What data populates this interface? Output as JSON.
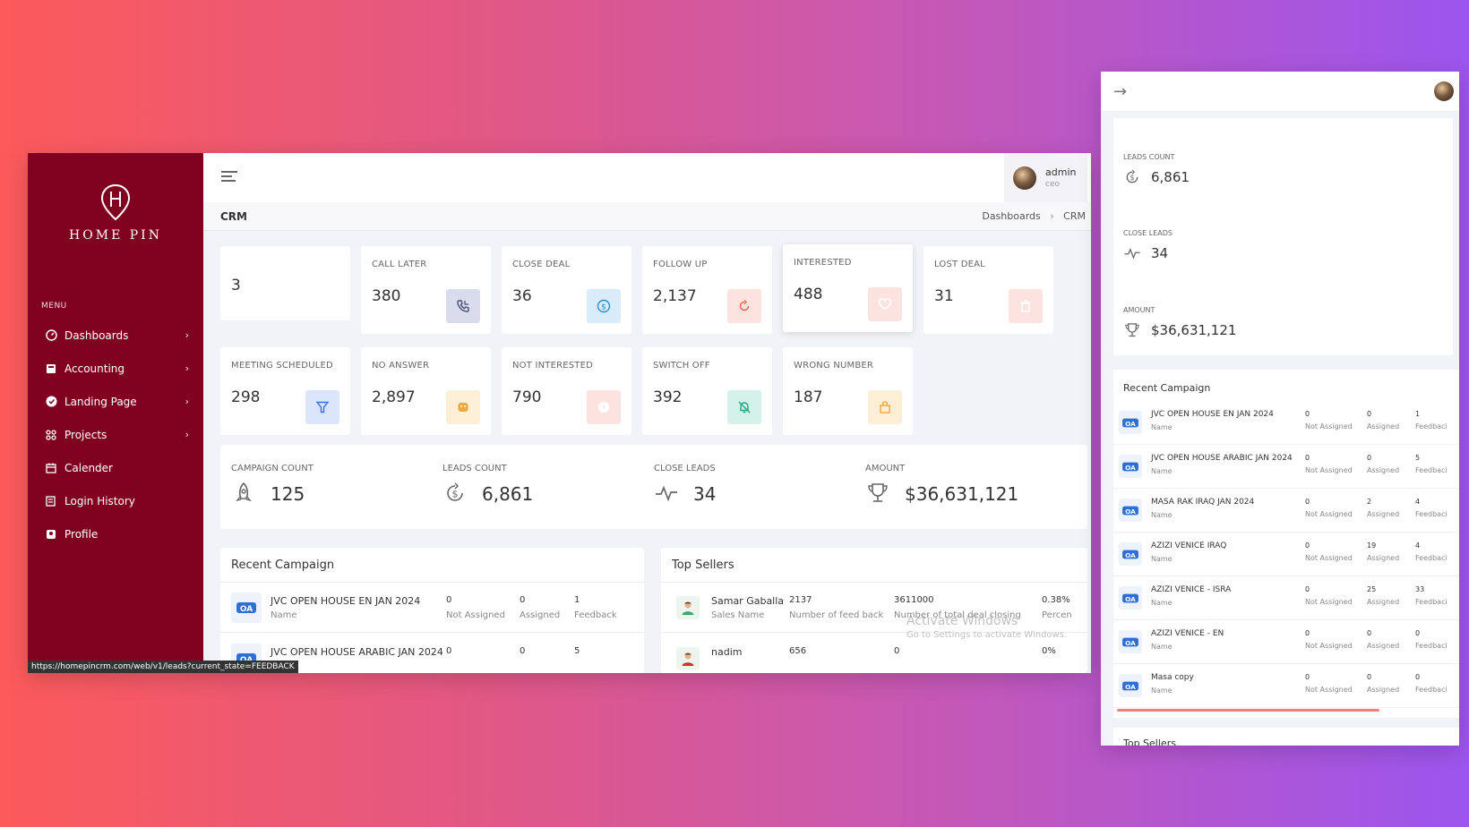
{
  "brand": {
    "name": "HOME PIN"
  },
  "sidebar": {
    "menu_title": "MENU",
    "items": [
      {
        "label": "Dashboards",
        "icon": "dashboard-icon",
        "has_children": true
      },
      {
        "label": "Accounting",
        "icon": "accounting-icon",
        "has_children": true
      },
      {
        "label": "Landing Page",
        "icon": "landing-page-icon",
        "has_children": true
      },
      {
        "label": "Projects",
        "icon": "projects-icon",
        "has_children": true
      },
      {
        "label": "Calender",
        "icon": "calendar-icon",
        "has_children": false
      },
      {
        "label": "Login History",
        "icon": "login-history-icon",
        "has_children": false
      },
      {
        "label": "Profile",
        "icon": "profile-icon",
        "has_children": false
      }
    ]
  },
  "header": {
    "user_name": "admin",
    "user_role": "ceo"
  },
  "page": {
    "title": "CRM",
    "breadcrumb": [
      "Dashboards",
      "CRM"
    ]
  },
  "stats": [
    {
      "label": "",
      "value": "3"
    },
    {
      "label": "CALL LATER",
      "value": "380",
      "icon": "phone-call-icon",
      "icon_bg": "#d9dcec",
      "icon_color": "#4a5078"
    },
    {
      "label": "CLOSE DEAL",
      "value": "36",
      "icon": "dollar-coin-icon",
      "icon_bg": "#d8ecfa",
      "icon_color": "#2b8ec9"
    },
    {
      "label": "FOLLOW UP",
      "value": "2,137",
      "icon": "refresh-icon",
      "icon_bg": "#fde3df",
      "icon_color": "#e7694e"
    },
    {
      "label": "INTERESTED",
      "value": "488",
      "icon": "heart-icon",
      "icon_bg": "#fde3df",
      "icon_color": "#ffffff"
    },
    {
      "label": "LOST DEAL",
      "value": "31",
      "icon": "trash-icon",
      "icon_bg": "#fde3df",
      "icon_color": "#ffffff"
    },
    {
      "label": "MEETING SCHEDULED",
      "value": "298",
      "icon": "filter-icon",
      "icon_bg": "#dce6fb",
      "icon_color": "#3e6fe0"
    },
    {
      "label": "NO ANSWER",
      "value": "2,897",
      "icon": "no-answer-icon",
      "icon_bg": "#fdefd6",
      "icon_color": "#f3a73a"
    },
    {
      "label": "NOT INTERESTED",
      "value": "790",
      "icon": "clock-icon",
      "icon_bg": "#fde3df",
      "icon_color": "#ffffff"
    },
    {
      "label": "SWITCH OFF",
      "value": "392",
      "icon": "bell-off-icon",
      "icon_bg": "#d4f1ea",
      "icon_color": "#1fa883"
    },
    {
      "label": "WRONG NUMBER",
      "value": "187",
      "icon": "bag-icon",
      "icon_bg": "#fdefd6",
      "icon_color": "#f3a73a"
    }
  ],
  "summary": [
    {
      "label": "CAMPAIGN COUNT",
      "value": "125",
      "icon": "rocket-icon"
    },
    {
      "label": "LEADS COUNT",
      "value": "6,861",
      "icon": "dollar-cycle-icon"
    },
    {
      "label": "CLOSE LEADS",
      "value": "34",
      "icon": "pulse-icon"
    },
    {
      "label": "AMOUNT",
      "value": "$36,631,121",
      "icon": "trophy-icon"
    }
  ],
  "recent_campaign": {
    "title": "Recent Campaign",
    "sub_name": "Name",
    "sub_not_assigned": "Not Assigned",
    "sub_assigned": "Assigned",
    "sub_feedback": "Feedback",
    "rows": [
      {
        "name": "JVC OPEN HOUSE EN JAN 2024",
        "not_assigned": "0",
        "assigned": "0",
        "feedback": "1"
      },
      {
        "name": "JVC OPEN HOUSE ARABIC JAN 2024",
        "not_assigned": "0",
        "assigned": "0",
        "feedback": "5"
      }
    ]
  },
  "top_sellers": {
    "title": "Top Sellers",
    "sub_name": "Sales Name",
    "sub_feedback": "Number of feed back",
    "sub_closing": "Number of total deal closing",
    "sub_percent": "Percen",
    "rows": [
      {
        "name": "Samar Gaballa",
        "feedback": "2137",
        "closing": "3611000",
        "percent": "0.38%"
      },
      {
        "name": "nadim",
        "feedback": "656",
        "closing": "0",
        "percent": "0%"
      }
    ]
  },
  "watermark": {
    "line1": "Activate Windows",
    "line2": "Go to Settings to activate Windows."
  },
  "status_bar": {
    "url": "https://homepincrm.com/web/v1/leads?current_state=FEEDBACK"
  },
  "mobile": {
    "summary": [
      {
        "label": "LEADS COUNT",
        "value": "6,861",
        "icon": "dollar-cycle-icon"
      },
      {
        "label": "CLOSE LEADS",
        "value": "34",
        "icon": "pulse-icon"
      },
      {
        "label": "AMOUNT",
        "value": "$36,631,121",
        "icon": "trophy-icon"
      }
    ],
    "recent_campaign": {
      "title": "Recent Campaign",
      "sub_name": "Name",
      "sub_not_assigned": "Not Assigned",
      "sub_assigned": "Assigned",
      "sub_feedback": "Feedbaci",
      "rows": [
        {
          "name": "JVC OPEN HOUSE EN JAN 2024",
          "not_assigned": "0",
          "assigned": "0",
          "feedback": "1"
        },
        {
          "name": "JVC OPEN HOUSE ARABIC JAN 2024",
          "not_assigned": "0",
          "assigned": "0",
          "feedback": "5"
        },
        {
          "name": "MASA RAK IRAQ JAN 2024",
          "not_assigned": "0",
          "assigned": "2",
          "feedback": "4"
        },
        {
          "name": "AZIZI VENICE IRAQ",
          "not_assigned": "0",
          "assigned": "19",
          "feedback": "4"
        },
        {
          "name": "AZIZI VENICE - ISRA",
          "not_assigned": "0",
          "assigned": "25",
          "feedback": "33"
        },
        {
          "name": "AZIZI VENICE - EN",
          "not_assigned": "0",
          "assigned": "0",
          "feedback": "0"
        },
        {
          "name": "Masa copy",
          "not_assigned": "0",
          "assigned": "0",
          "feedback": "0"
        }
      ]
    },
    "top_sellers_title": "Top Sellers"
  }
}
